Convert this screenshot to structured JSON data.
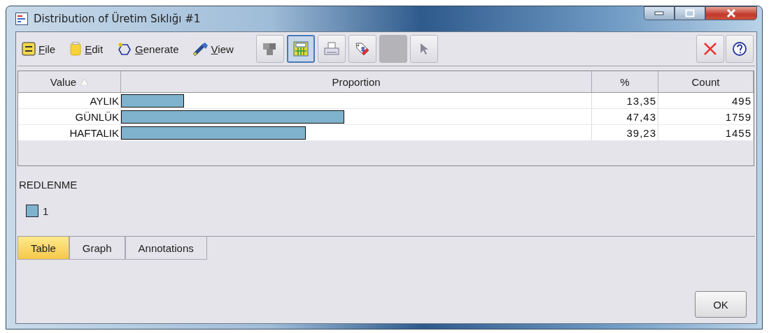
{
  "window": {
    "title": "Distribution of Üretim Sıklığı #1"
  },
  "menu": [
    {
      "kind": "file",
      "label": "File"
    },
    {
      "kind": "edit",
      "label": "Edit"
    },
    {
      "kind": "generate",
      "label": "Generate"
    },
    {
      "kind": "view",
      "label": "View"
    }
  ],
  "toolbar": [
    {
      "kind": "layers",
      "selected": false
    },
    {
      "kind": "table",
      "selected": true
    },
    {
      "kind": "print",
      "selected": false
    },
    {
      "kind": "tag",
      "selected": false
    },
    {
      "kind": "blank",
      "selected": false
    },
    {
      "kind": "pointer",
      "selected": false
    }
  ],
  "table": {
    "columns": [
      {
        "label": "Value",
        "sorted": true
      },
      {
        "label": "Proportion",
        "sorted": false
      },
      {
        "label": "%",
        "sorted": false
      },
      {
        "label": "Count",
        "sorted": false
      }
    ],
    "rows": [
      {
        "value": "AYLIK",
        "level": 0.1335,
        "percent": "13,35",
        "count": "495"
      },
      {
        "value": "GÜNLÜK",
        "level": 0.4743,
        "percent": "47,43",
        "count": "1759"
      },
      {
        "value": "HAFTALIK",
        "level": 0.3923,
        "percent": "39,23",
        "count": "1455"
      }
    ]
  },
  "legend": {
    "title": "REDLENME",
    "items": [
      {
        "label": "1",
        "color": "#7fb3cd"
      }
    ]
  },
  "tabs": [
    {
      "label": "Table",
      "selected": true
    },
    {
      "label": "Graph",
      "selected": false
    },
    {
      "label": "Annotations",
      "selected": false
    }
  ],
  "buttons": [
    "OK"
  ]
}
